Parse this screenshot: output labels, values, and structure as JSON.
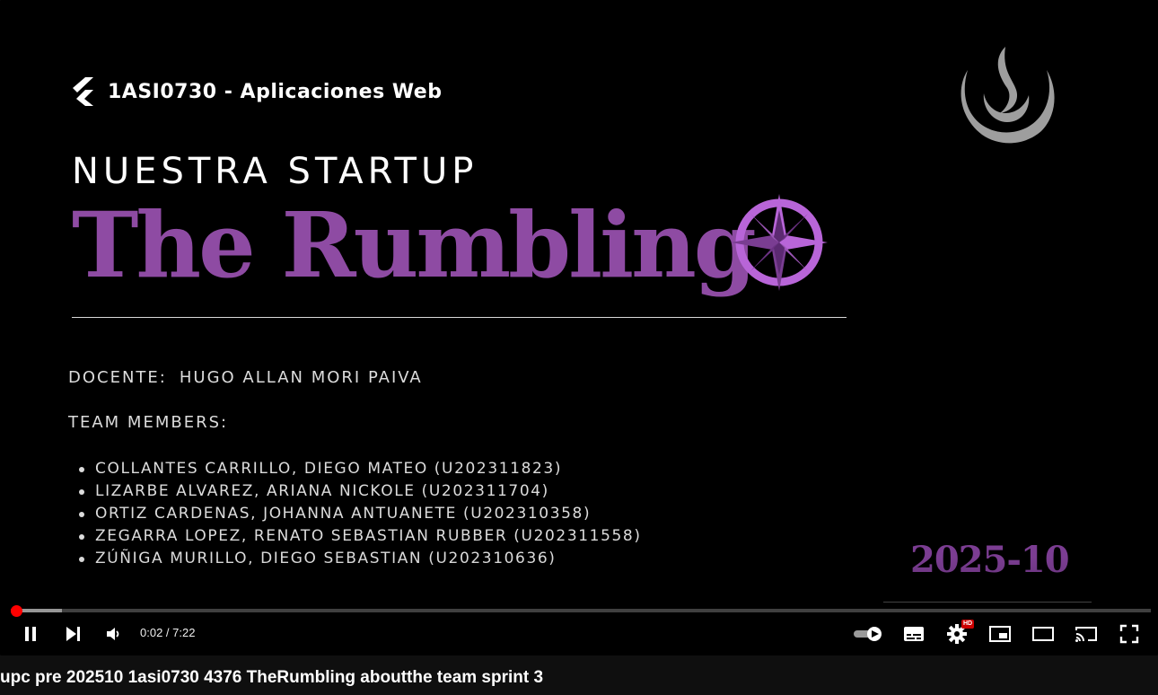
{
  "slide": {
    "course": "1ASI0730 - Aplicaciones Web",
    "kicker": "NUESTRA STARTUP",
    "startup_name": "The Rumbling",
    "teacher_label": "DOCENTE:",
    "teacher_name": "HUGO ALLAN MORI PAIVA",
    "members_title": "TEAM MEMBERS:",
    "members": [
      "COLLANTES CARRILLO, DIEGO MATEO (U202311823)",
      "LIZARBE ALVAREZ, ARIANA NICKOLE (U202311704)",
      "ORTIZ CARDENAS, JOHANNA ANTUANETE (U202310358)",
      "ZEGARRA LOPEZ, RENATO SEBASTIAN RUBBER (U202311558)",
      "ZÚÑIGA MURILLO, DIEGO SEBASTIAN (U202310636)"
    ],
    "year": "2025-10"
  },
  "player": {
    "time_display": "0:02 / 7:22",
    "progress_fraction": 0.0045,
    "buffered_fraction": 0.045,
    "hd_badge": "HD",
    "icons": [
      "pause-icon",
      "next-icon",
      "volume-icon",
      "autoplay-toggle-icon",
      "subtitles-icon",
      "settings-icon",
      "miniplayer-icon",
      "theater-icon",
      "cast-icon",
      "fullscreen-icon"
    ]
  },
  "video_title": "upc pre 202510 1asi0730 4376 TheRumbling aboutthe team sprint 3",
  "colors": {
    "accent_purple": "#8e4ba3",
    "compass_purple": "#b865d8",
    "progress_red": "#ff0000",
    "logo_gray": "#9e9e9e"
  }
}
